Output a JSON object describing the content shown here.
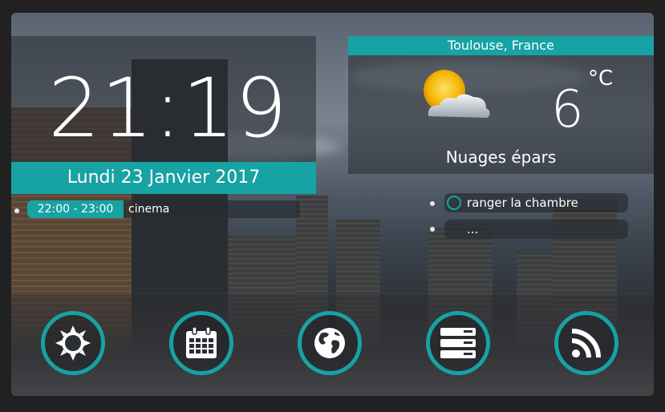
{
  "clock": {
    "time": "21:19",
    "date": "Lundi 23 Janvier 2017"
  },
  "weather": {
    "city": "Toulouse, France",
    "temperature": "6",
    "unit": "°C",
    "description": "Nuages épars",
    "icon": "sun-behind-cloud-icon"
  },
  "agenda": {
    "events": [
      {
        "time": "22:00 - 23:00",
        "label": "cinema"
      }
    ]
  },
  "todo": {
    "tasks": [
      {
        "label": "ranger la chambre"
      },
      {
        "label": "..."
      }
    ]
  },
  "dock": {
    "buttons": [
      {
        "name": "settings-button",
        "icon": "sun-gear-icon"
      },
      {
        "name": "calendar-button",
        "icon": "calendar-icon"
      },
      {
        "name": "globe-button",
        "icon": "globe-icon"
      },
      {
        "name": "server-button",
        "icon": "server-icon"
      },
      {
        "name": "rss-button",
        "icon": "rss-icon"
      }
    ]
  },
  "colors": {
    "accent": "#17a2a3",
    "background": "#212121"
  }
}
